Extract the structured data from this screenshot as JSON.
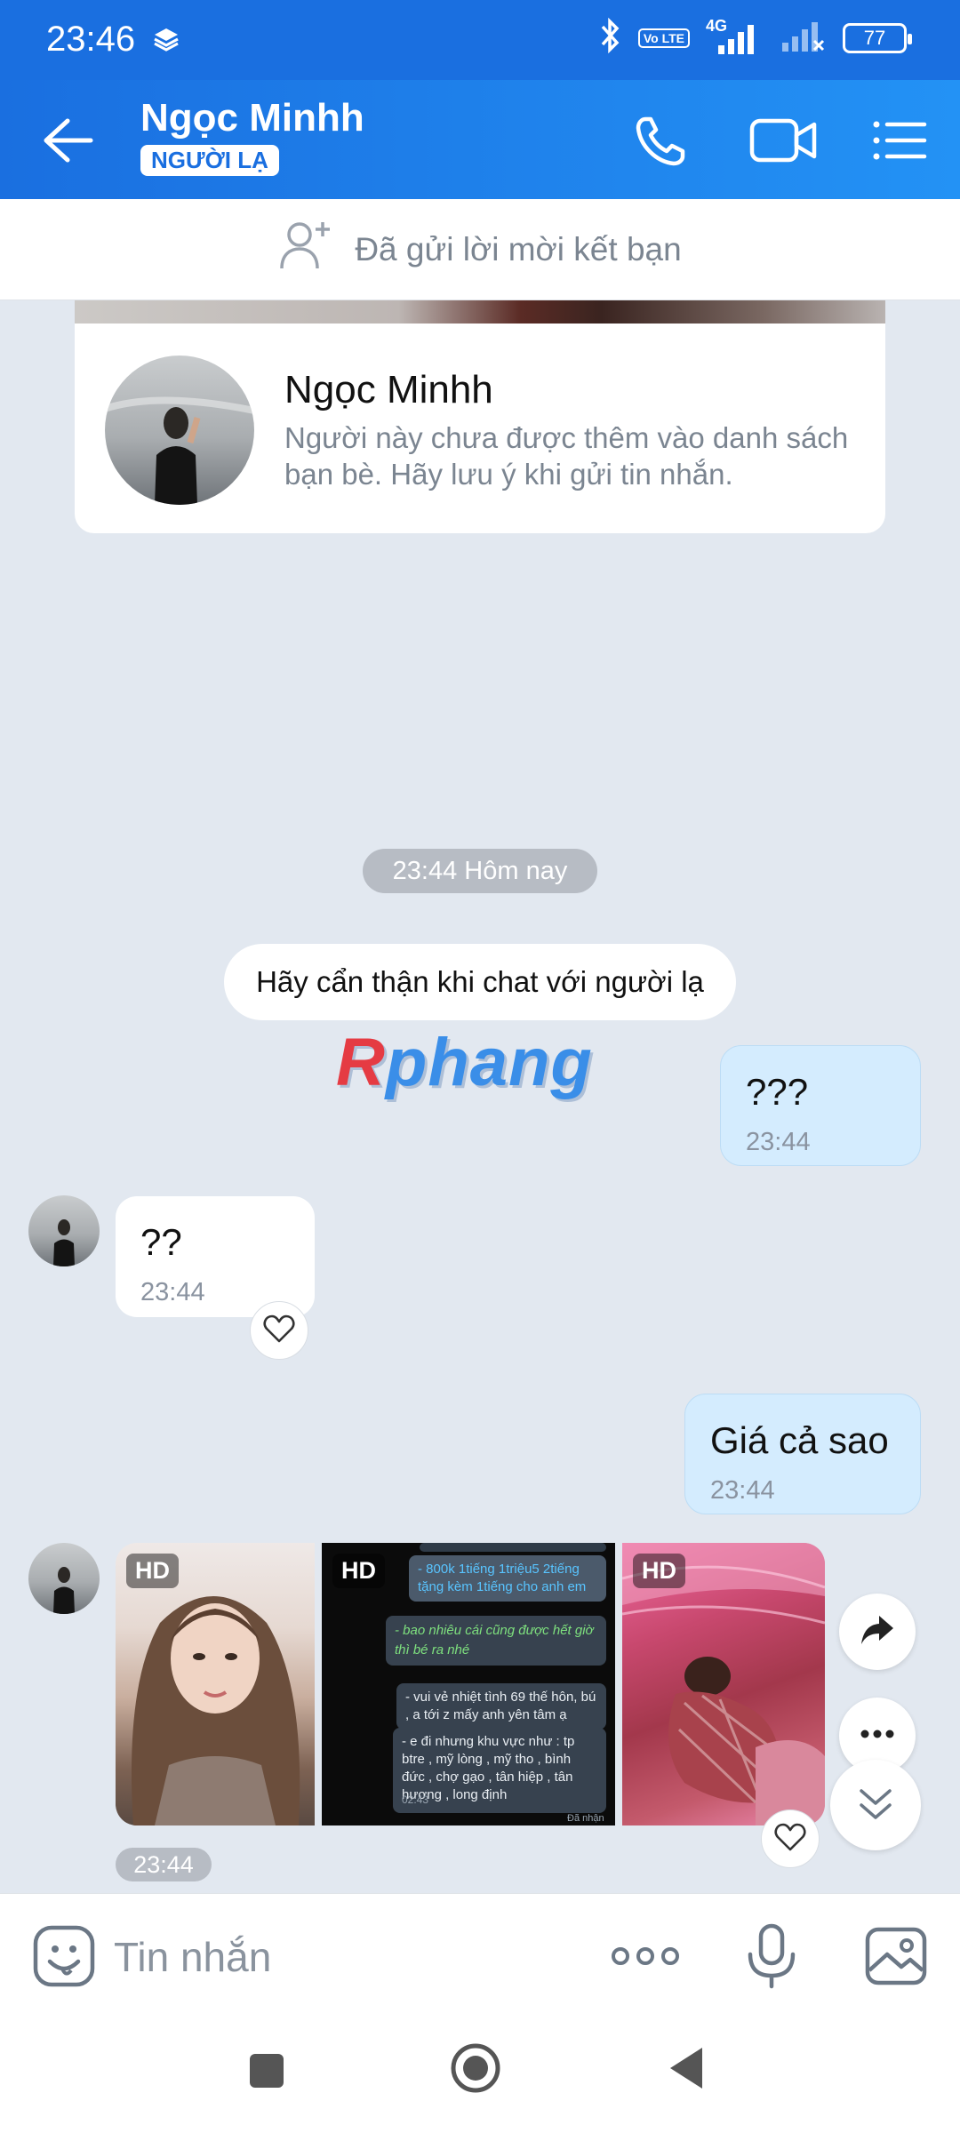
{
  "status_bar": {
    "time": "23:46",
    "network": "4G",
    "volte": "Vo LTE",
    "battery": "77"
  },
  "header": {
    "name": "Ngọc Minhh",
    "badge": "NGƯỜI LẠ"
  },
  "friend_request": {
    "text": "Đã gửi lời mời kết bạn"
  },
  "profile_card": {
    "name": "Ngọc Minhh",
    "note": "Người này chưa được thêm vào danh sách bạn bè. Hãy lưu ý khi gửi tin nhắn."
  },
  "chat": {
    "date_pill": "23:44 Hôm nay",
    "notice": "Hãy cẩn thận khi chat với người lạ",
    "watermark_a": "R",
    "watermark_b": "phang",
    "messages": [
      {
        "sender": "me",
        "text": "???",
        "time": "23:44"
      },
      {
        "sender": "them",
        "text": "??",
        "time": "23:44"
      },
      {
        "sender": "me",
        "text": "Giá cả sao",
        "time": "23:44"
      }
    ],
    "photos": {
      "hd_label": "HD",
      "time": "23:44",
      "screenshot_lines": [
        "- 800k 1tiếng 1triệu5 2tiếng tặng kèm 1tiếng cho anh em",
        "- bao nhiêu cái cũng được hết giờ thì bé ra nhé",
        "- vui vẻ nhiệt tình 69 thế hôn, bú , a tới z mấy anh yên tâm ạ",
        "- e đi nhưng khu vực như : tp btre , mỹ lòng , mỹ tho , bình đức , chợ gạo , tân hiệp , tân hương , long định",
        "02:43",
        "Đã nhận"
      ]
    }
  },
  "input": {
    "placeholder": "Tin nhắn"
  },
  "colors": {
    "header_blue": "#1a6fe0",
    "chat_bg": "#e2e8f0",
    "my_bubble": "#d4ecfe"
  }
}
